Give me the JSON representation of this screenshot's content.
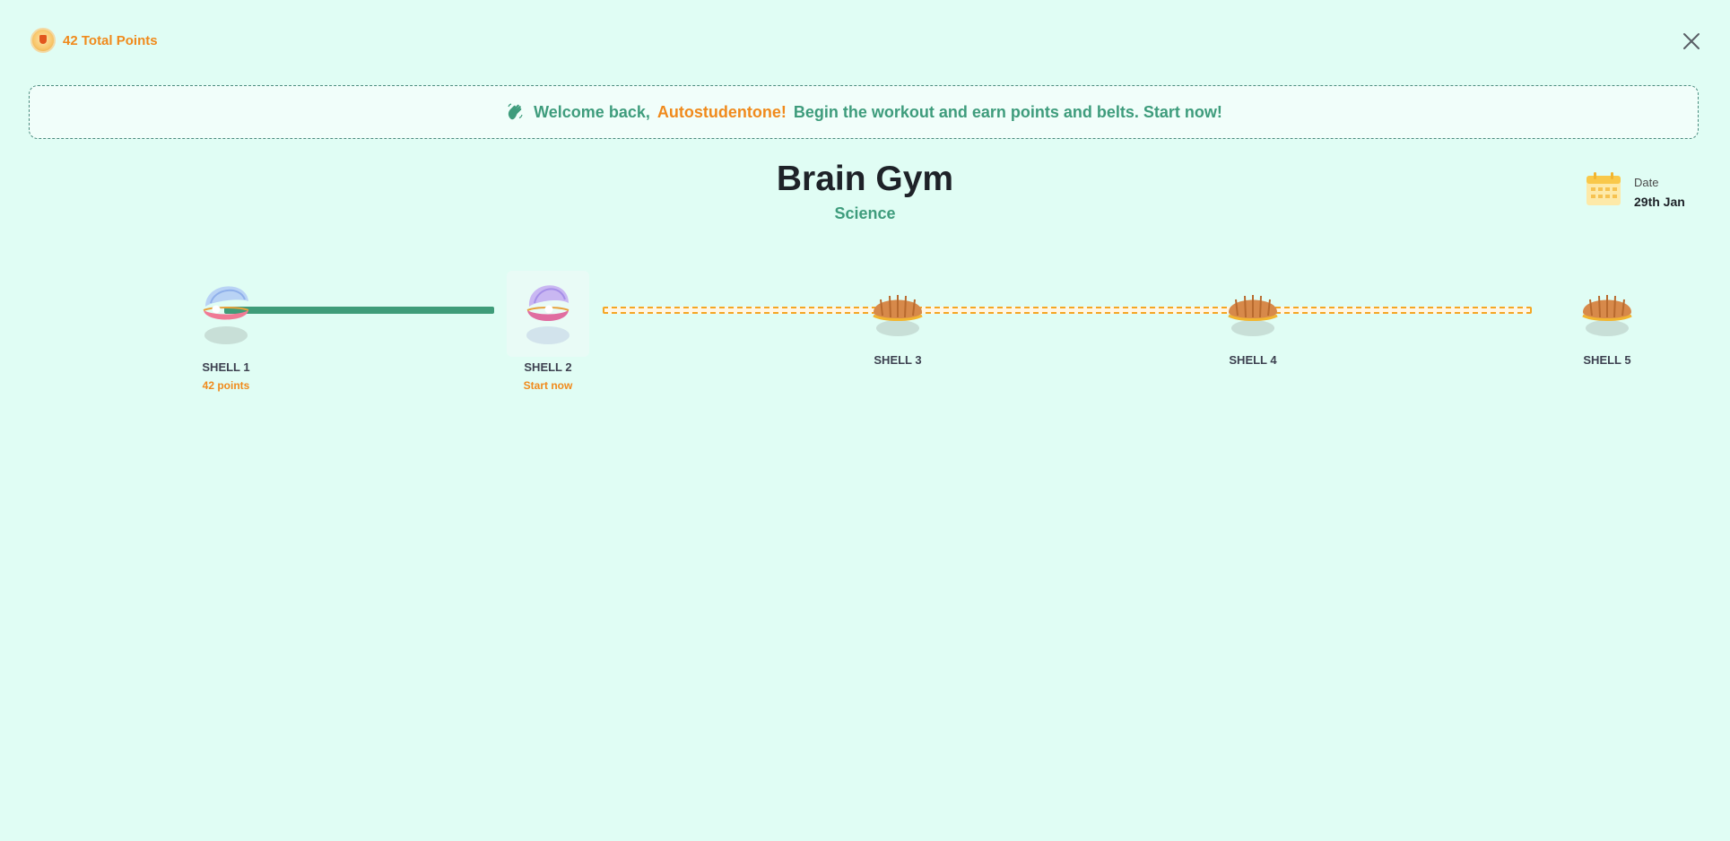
{
  "header": {
    "points_label": "42 Total Points"
  },
  "banner": {
    "greeting": "Welcome back,",
    "username": "Autostudentone!",
    "message": "Begin the workout and earn points and belts. Start now!"
  },
  "page": {
    "title": "Brain Gym",
    "subject": "Science"
  },
  "date": {
    "label": "Date",
    "value": "29th Jan"
  },
  "shells": [
    {
      "label": "SHELL 1",
      "status": "42 points"
    },
    {
      "label": "SHELL 2",
      "status": "Start now"
    },
    {
      "label": "SHELL 3",
      "status": ""
    },
    {
      "label": "SHELL 4",
      "status": ""
    },
    {
      "label": "SHELL 5",
      "status": ""
    }
  ],
  "colors": {
    "background": "#e0fdf4",
    "accent_green": "#3e9c7c",
    "accent_orange": "#f08a1c",
    "title": "#1e2228"
  },
  "icons": {
    "points": "medal-icon",
    "close": "close-icon",
    "greeting": "waving-hand-icon",
    "date": "calendar-icon",
    "open_shell": "open-pearl-shell-icon",
    "closed_shell": "closed-shell-icon"
  }
}
